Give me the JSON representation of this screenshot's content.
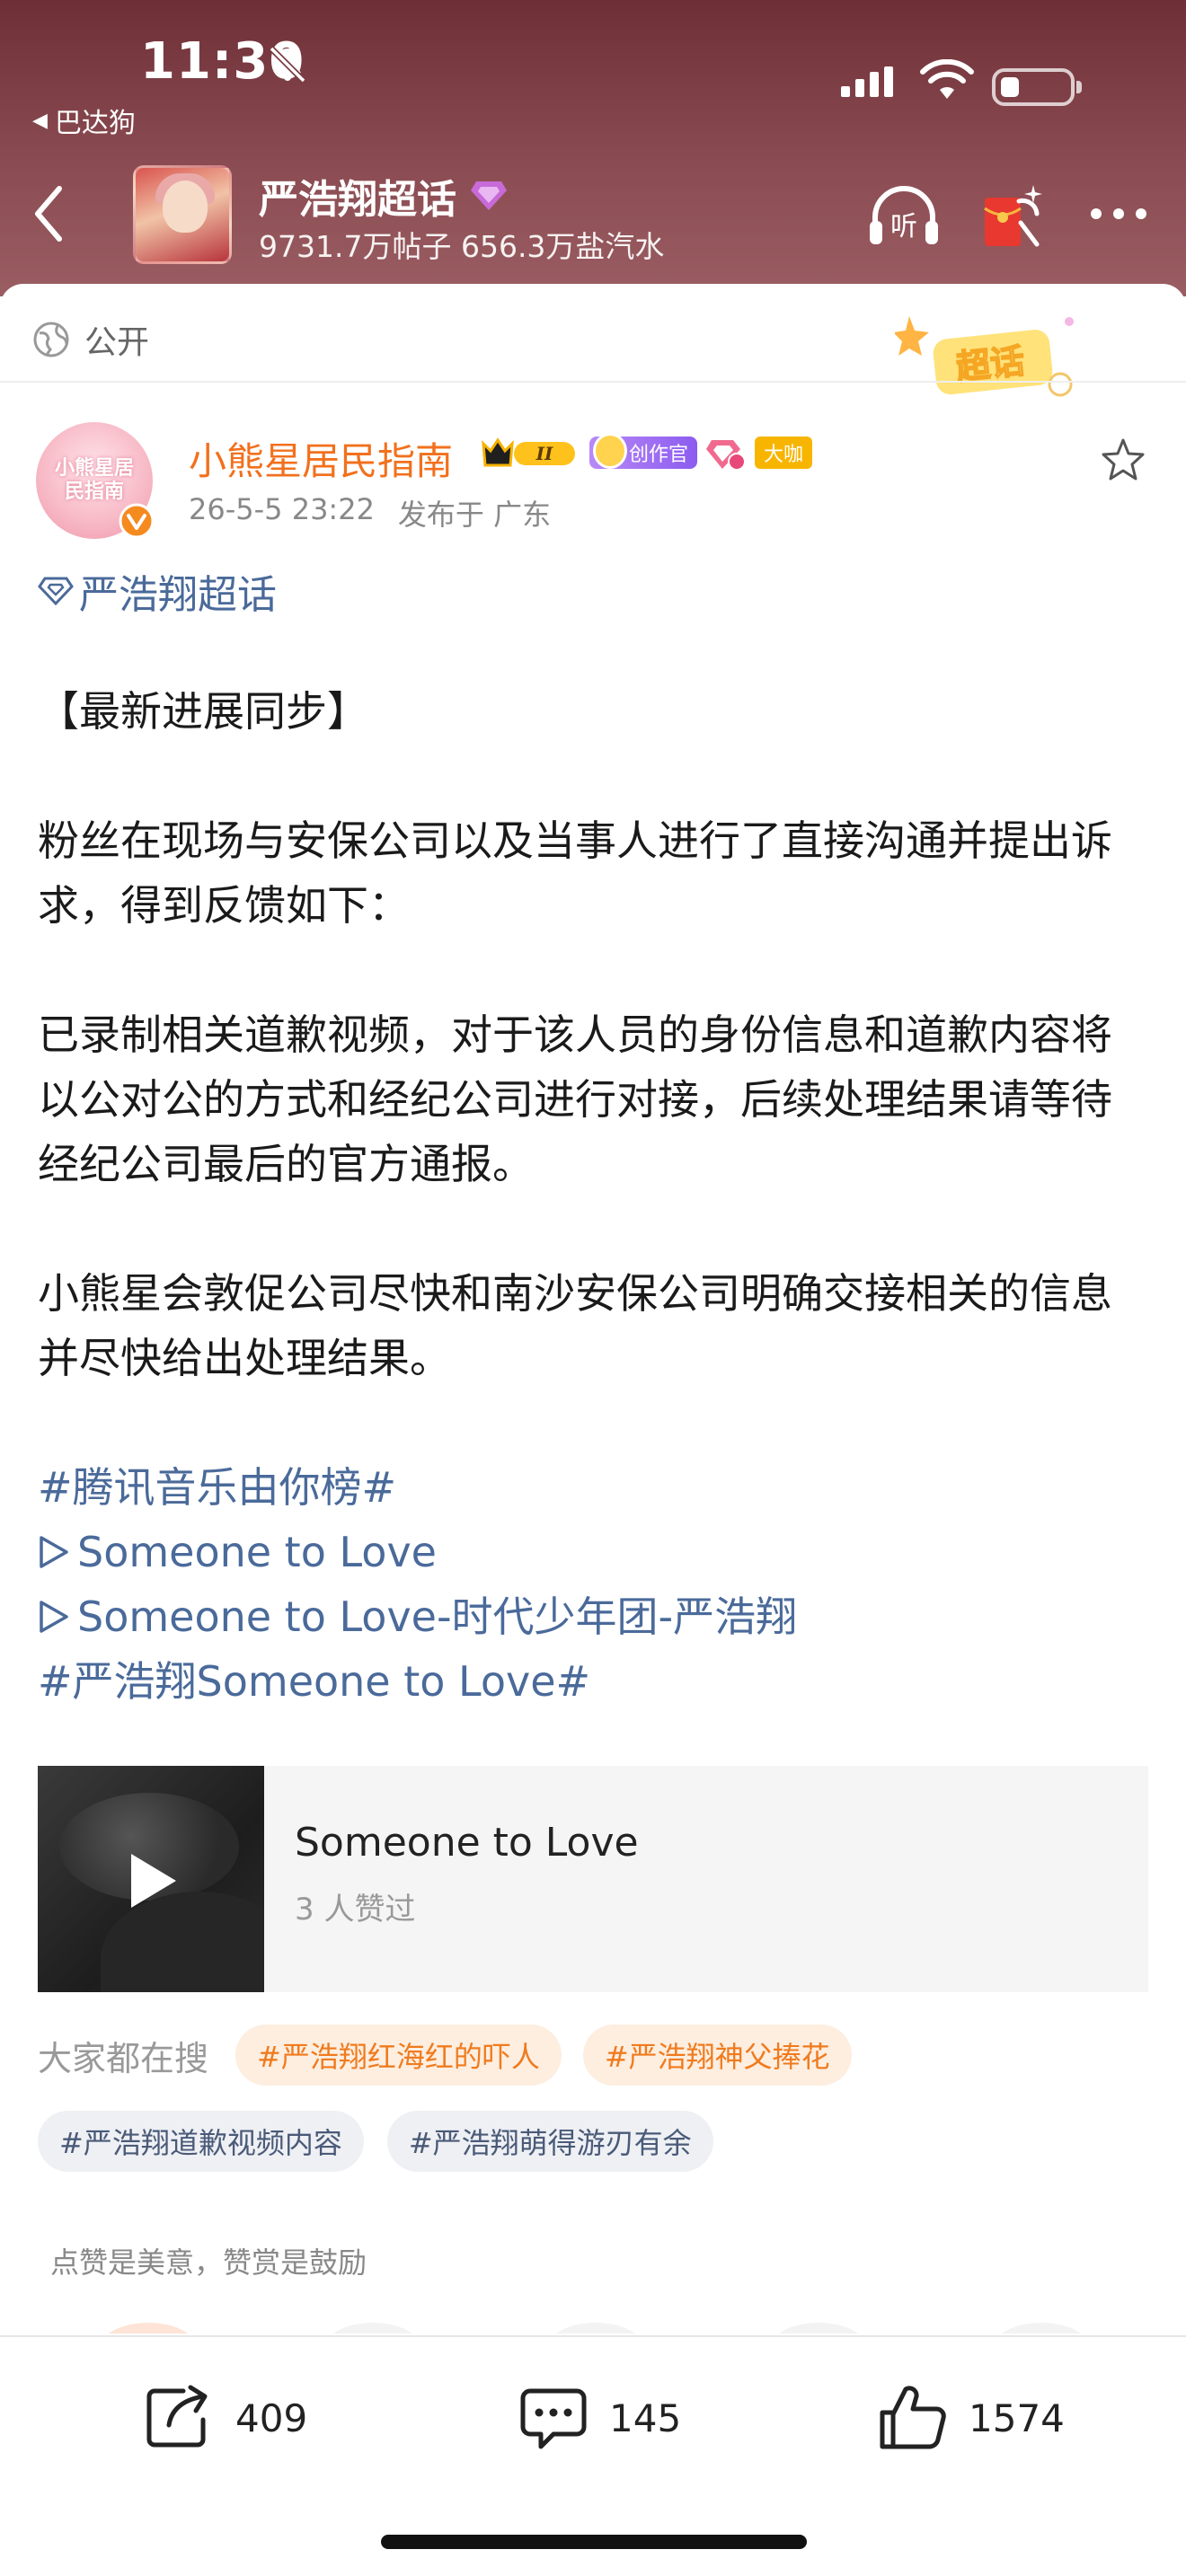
{
  "status_bar": {
    "time": "11:30",
    "back_app_label": "巴达狗"
  },
  "topic_header": {
    "title": "严浩翔超话",
    "stats": "9731.7万帖子 656.3万盐汽水",
    "listen_icon": "listen-icon",
    "redpacket_icon": "red-packet-icon",
    "more_icon": "more-icon"
  },
  "visibility": {
    "label": "公开",
    "badge_text": "超话"
  },
  "post": {
    "author": {
      "name": "小熊星居民指南",
      "avatar_text": "小熊星居民指南",
      "badge_level": "II",
      "badge_creator": "创作官",
      "badge_vip": "大咖"
    },
    "date": "26-5-5 23:22",
    "location": "发布于 广东",
    "topic": "严浩翔超话",
    "paragraphs": [
      "【最新进展同步】",
      "粉丝在现场与安保公司以及当事人进行了直接沟通并提出诉求，得到反馈如下：",
      "已录制相关道歉视频，对于该人员的身份信息和道歉内容将以公对公的方式和经纪公司进行对接，后续处理结果请等待经纪公司最后的官方通报。",
      "小熊星会敦促公司尽快和南沙安保公司明确交接相关的信息并尽快给出处理结果。"
    ],
    "links": {
      "hashtag1": "#腾讯音乐由你榜#",
      "song1": "Someone to Love",
      "song2": "Someone to Love-时代少年团-严浩翔",
      "hashtag2": "#严浩翔Someone to Love#"
    },
    "media": {
      "title": "Someone to Love",
      "likes": "3 人赞过"
    }
  },
  "search": {
    "label": "大家都在搜",
    "tags_orange": [
      "#严浩翔红海红的吓人",
      "#严浩翔神父捧花"
    ],
    "tags_gray": [
      "#严浩翔道歉视频内容",
      "#严浩翔萌得游刃有余"
    ]
  },
  "reward_text": "点赞是美意，赞赏是鼓励",
  "actions": {
    "repost": "409",
    "comment": "145",
    "like": "1574"
  },
  "colors": {
    "header": "#7a3c42",
    "author_name": "#f2701d",
    "link": "#4a6a9a",
    "tag_orange_bg": "#fdeee0",
    "tag_gray_bg": "#eef0f4"
  }
}
